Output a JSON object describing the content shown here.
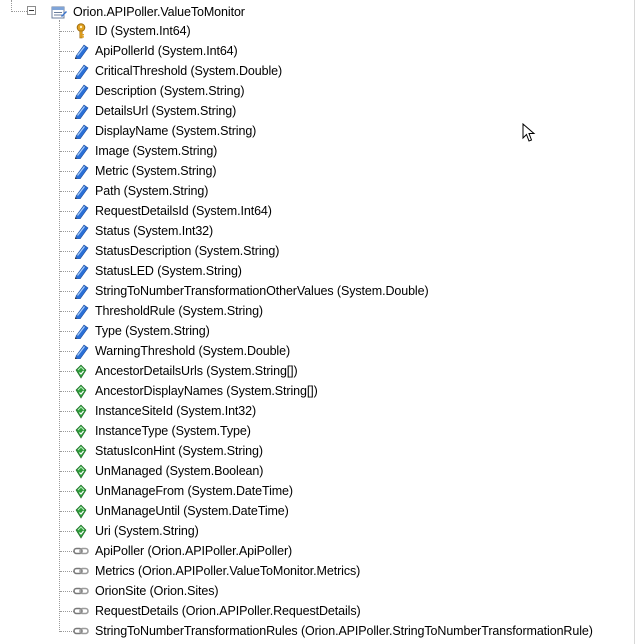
{
  "root": {
    "label": "Orion.APIPoller.ValueToMonitor",
    "icon": "entity-table-icon",
    "expanded": true
  },
  "items": [
    {
      "label": "ID (System.Int64)",
      "kind": "key",
      "icon": "key-icon"
    },
    {
      "label": "ApiPollerId (System.Int64)",
      "kind": "property",
      "icon": "property-icon"
    },
    {
      "label": "CriticalThreshold (System.Double)",
      "kind": "property",
      "icon": "property-icon"
    },
    {
      "label": "Description (System.String)",
      "kind": "property",
      "icon": "property-icon"
    },
    {
      "label": "DetailsUrl (System.String)",
      "kind": "property",
      "icon": "property-icon"
    },
    {
      "label": "DisplayName (System.String)",
      "kind": "property",
      "icon": "property-icon"
    },
    {
      "label": "Image (System.String)",
      "kind": "property",
      "icon": "property-icon"
    },
    {
      "label": "Metric (System.String)",
      "kind": "property",
      "icon": "property-icon"
    },
    {
      "label": "Path (System.String)",
      "kind": "property",
      "icon": "property-icon"
    },
    {
      "label": "RequestDetailsId (System.Int64)",
      "kind": "property",
      "icon": "property-icon"
    },
    {
      "label": "Status (System.Int32)",
      "kind": "property",
      "icon": "property-icon"
    },
    {
      "label": "StatusDescription (System.String)",
      "kind": "property",
      "icon": "property-icon"
    },
    {
      "label": "StatusLED (System.String)",
      "kind": "property",
      "icon": "property-icon"
    },
    {
      "label": "StringToNumberTransformationOtherValues (System.Double)",
      "kind": "property",
      "icon": "property-icon"
    },
    {
      "label": "ThresholdRule (System.String)",
      "kind": "property",
      "icon": "property-icon"
    },
    {
      "label": "Type (System.String)",
      "kind": "property",
      "icon": "property-icon"
    },
    {
      "label": "WarningThreshold (System.Double)",
      "kind": "property",
      "icon": "property-icon"
    },
    {
      "label": "AncestorDetailsUrls (System.String[])",
      "kind": "inherited",
      "icon": "inherited-property-icon"
    },
    {
      "label": "AncestorDisplayNames (System.String[])",
      "kind": "inherited",
      "icon": "inherited-property-icon"
    },
    {
      "label": "InstanceSiteId (System.Int32)",
      "kind": "inherited",
      "icon": "inherited-property-icon"
    },
    {
      "label": "InstanceType (System.Type)",
      "kind": "inherited",
      "icon": "inherited-property-icon"
    },
    {
      "label": "StatusIconHint (System.String)",
      "kind": "inherited",
      "icon": "inherited-property-icon"
    },
    {
      "label": "UnManaged (System.Boolean)",
      "kind": "inherited",
      "icon": "inherited-property-icon"
    },
    {
      "label": "UnManageFrom (System.DateTime)",
      "kind": "inherited",
      "icon": "inherited-property-icon"
    },
    {
      "label": "UnManageUntil (System.DateTime)",
      "kind": "inherited",
      "icon": "inherited-property-icon"
    },
    {
      "label": "Uri (System.String)",
      "kind": "inherited",
      "icon": "inherited-property-icon"
    },
    {
      "label": "ApiPoller (Orion.APIPoller.ApiPoller)",
      "kind": "link",
      "icon": "navigation-link-icon"
    },
    {
      "label": "Metrics (Orion.APIPoller.ValueToMonitor.Metrics)",
      "kind": "link",
      "icon": "navigation-link-icon"
    },
    {
      "label": "OrionSite (Orion.Sites)",
      "kind": "link",
      "icon": "navigation-link-icon"
    },
    {
      "label": "RequestDetails (Orion.APIPoller.RequestDetails)",
      "kind": "link",
      "icon": "navigation-link-icon"
    },
    {
      "label": "StringToNumberTransformationRules (Orion.APIPoller.StringToNumberTransformationRule)",
      "kind": "link",
      "icon": "navigation-link-icon"
    }
  ],
  "colors": {
    "property_blue": "#2a6fd6",
    "inherited_green": "#2e9a3a",
    "key_gold": "#e0a020",
    "link_gray": "#7a7a7a"
  }
}
